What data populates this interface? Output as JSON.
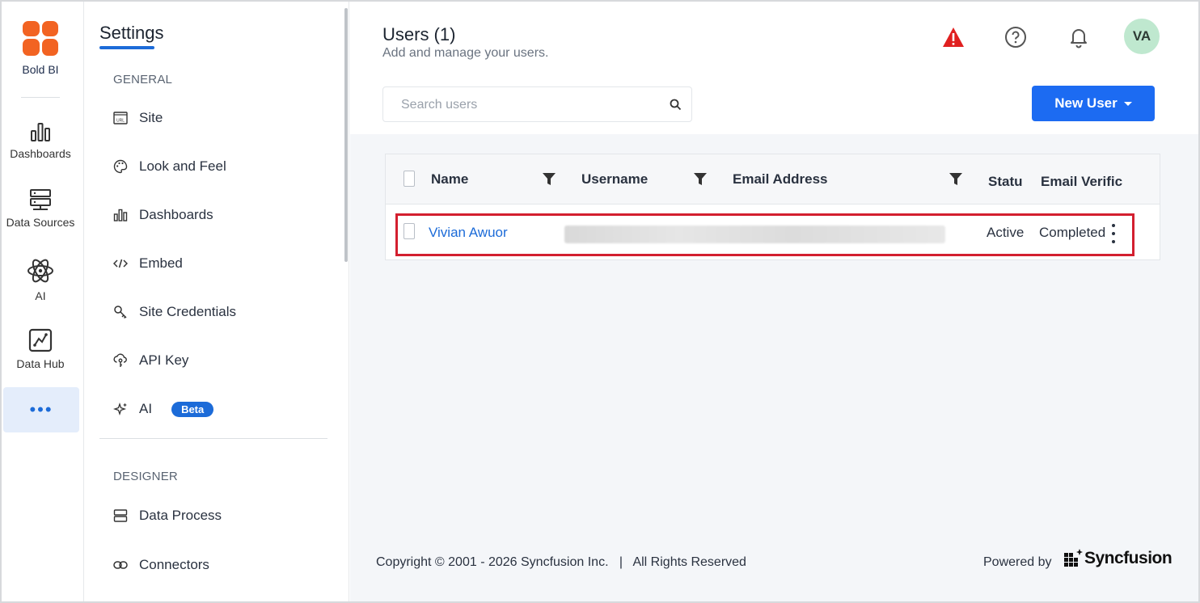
{
  "rail": {
    "brand_label": "Bold BI",
    "items": [
      {
        "label": "Dashboards",
        "icon": "bar-chart-icon"
      },
      {
        "label": "Data Sources",
        "icon": "server-icon"
      },
      {
        "label": "AI",
        "icon": "atom-icon"
      },
      {
        "label": "Data Hub",
        "icon": "chart-box-icon"
      }
    ],
    "more_label": "•••"
  },
  "settings": {
    "title": "Settings",
    "general_label": "GENERAL",
    "general_items": [
      {
        "label": "Site",
        "icon": "url-icon"
      },
      {
        "label": "Look and Feel",
        "icon": "palette-icon"
      },
      {
        "label": "Dashboards",
        "icon": "bar-chart-icon"
      },
      {
        "label": "Embed",
        "icon": "code-icon"
      },
      {
        "label": "Site Credentials",
        "icon": "key-icon"
      },
      {
        "label": "API Key",
        "icon": "cloud-key-icon"
      },
      {
        "label": "AI",
        "icon": "sparkle-icon",
        "badge": "Beta"
      }
    ],
    "designer_label": "DESIGNER",
    "designer_items": [
      {
        "label": "Data Process",
        "icon": "layers-icon"
      },
      {
        "label": "Connectors",
        "icon": "link-icon"
      }
    ]
  },
  "header": {
    "title": "Users (1)",
    "subtitle": "Add and manage your users.",
    "avatar_initials": "VA"
  },
  "search": {
    "placeholder": "Search users"
  },
  "actions": {
    "new_user_label": "New User"
  },
  "table": {
    "columns": [
      "Name",
      "Username",
      "Email Address",
      "Statu",
      "Email Verific"
    ],
    "rows": [
      {
        "name": "Vivian Awuor",
        "status": "Active",
        "email_verification": "Completed"
      }
    ]
  },
  "footer": {
    "copyright": "Copyright © 2001 - 2026 Syncfusion Inc.   |   All Rights Reserved",
    "powered_by": "Powered by",
    "brand": "Syncfusion"
  },
  "colors": {
    "accent": "#1c6bd8",
    "button": "#1c6bf2",
    "highlight": "#d31f2f",
    "warning": "#e02020",
    "logo": "#f26322"
  }
}
